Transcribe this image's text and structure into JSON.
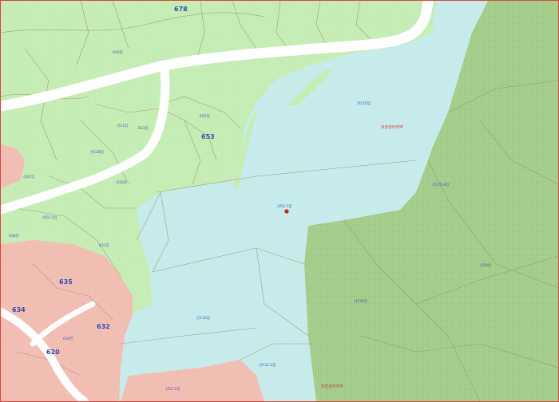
{
  "map": {
    "colors": {
      "forest_light": "#c8eeb8",
      "forest_dark": "#a7cf8e",
      "water": "#c8ecec",
      "residential": "#f3c0b6",
      "road": "#ffffff",
      "parcel_line": "#9a8f6a",
      "marker": "#d11f1f"
    },
    "block_numbers": {
      "b678": "678",
      "b653": "653",
      "b635": "635",
      "b634": "634",
      "b632": "632",
      "b620": "620"
    },
    "parcel_labels": {
      "p_target": "산52-7임",
      "p_top_right": "산125임",
      "p_right_mid": "산125-8임",
      "p_right_low": "산29임",
      "p_lake1": "산135임",
      "p_lake2": "산136임",
      "p_bottom1": "산132-2임",
      "p_bottom2": "산52-2임",
      "p_left1": "산21임",
      "p_left2": "산11임",
      "p_left3": "산138임",
      "p_left4": "산52-1임",
      "p_left5": "638전",
      "p_left6": "630전",
      "p_left7": "631임",
      "p_left8": "632답",
      "p_left9": "650임",
      "p_left10": "651임",
      "p_left11": "652임"
    },
    "red_labels": {
      "r1": "보전관리지역",
      "r2": "보전관리지역"
    }
  }
}
